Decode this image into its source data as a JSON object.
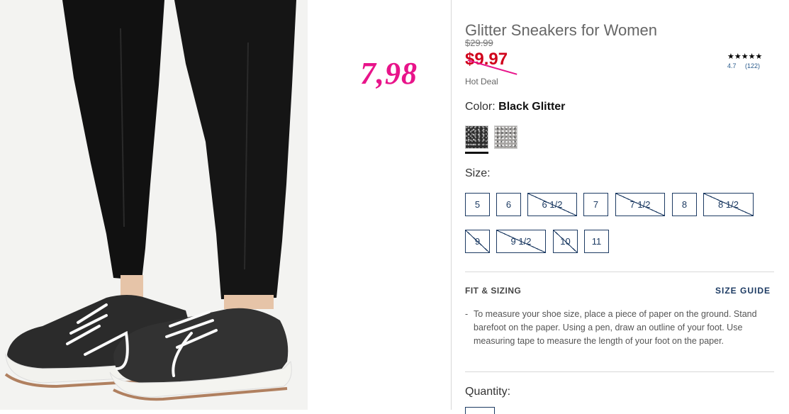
{
  "annotation": {
    "handwritten_price": "7,98"
  },
  "product": {
    "title": "Glitter Sneakers for Women",
    "original_price": "$29.99",
    "sale_price": "$9.97",
    "deal_label": "Hot Deal",
    "rating": {
      "stars": "★★★★★",
      "score": "4.7",
      "count": "(122)"
    },
    "color": {
      "label": "Color:",
      "selected": "Black Glitter",
      "swatches": [
        {
          "name": "Black Glitter",
          "selected": true
        },
        {
          "name": "Silver Glitter",
          "selected": false
        }
      ]
    },
    "size": {
      "label": "Size:",
      "options": [
        {
          "value": "5",
          "available": true
        },
        {
          "value": "6",
          "available": true
        },
        {
          "value": "6 1/2",
          "available": false
        },
        {
          "value": "7",
          "available": true
        },
        {
          "value": "7 1/2",
          "available": false
        },
        {
          "value": "8",
          "available": true
        },
        {
          "value": "8 1/2",
          "available": false
        },
        {
          "value": "9",
          "available": false
        },
        {
          "value": "9 1/2",
          "available": false
        },
        {
          "value": "10",
          "available": false
        },
        {
          "value": "11",
          "available": true
        }
      ]
    },
    "fit": {
      "title": "FIT & SIZING",
      "guide_link": "SIZE GUIDE",
      "bullet": "-",
      "text": "To measure your shoe size, place a piece of paper on the ground. Stand barefoot on the paper. Using a pen, draw an outline of your foot. Use measuring tape to measure the length of your foot on the paper."
    },
    "quantity_label": "Quantity:"
  },
  "colors": {
    "accent_navy": "#1d3b63",
    "sale_red": "#d0021b",
    "annotation_pink": "#e8148a"
  }
}
